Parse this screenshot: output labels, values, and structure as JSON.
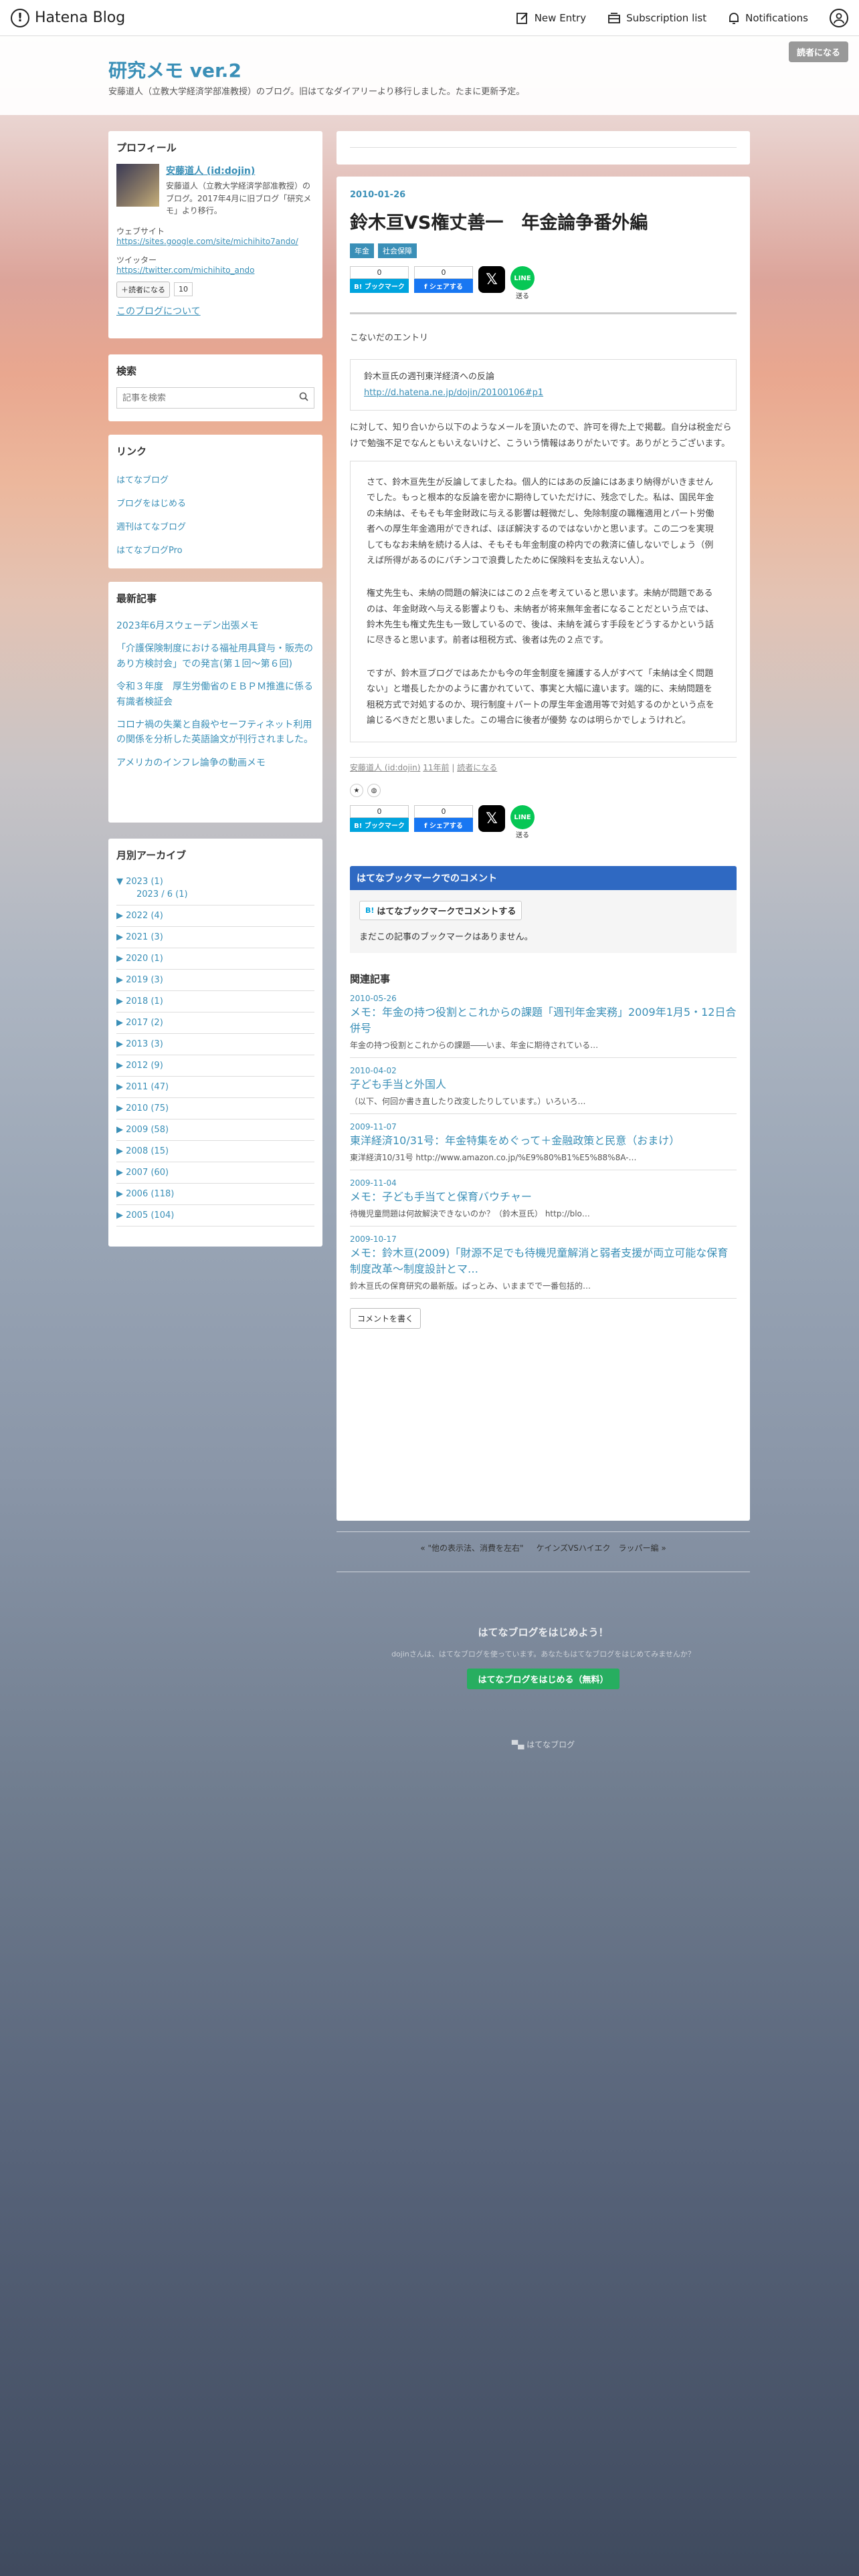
{
  "topbar": {
    "brand": "Hatena Blog",
    "new_entry": "New Entry",
    "subscription_list": "Subscription list",
    "notifications": "Notifications"
  },
  "header": {
    "title": "研究メモ ver.2",
    "description": "安藤道人（立教大学経済学部准教授）のブログ。旧はてなダイアリーより移行しました。たまに更新予定。",
    "reader_button": "読者になる"
  },
  "sidebar": {
    "profile": {
      "title": "プロフィール",
      "name": "安藤道人 (id:dojin)",
      "text": "安藤道人（立教大学経済学部准教授）のブログ。2017年4月に旧ブログ「研究メモ」より移行。",
      "website_label": "ウェブサイト",
      "website_url": "https://sites.google.com/site/michihito7ando/",
      "twitter_label": "ツイッター",
      "twitter_url": "https://twitter.com/michihito_ando",
      "follow_button": "読者になる",
      "follow_count": "10",
      "about_link": "このブログについて"
    },
    "search": {
      "title": "検索",
      "placeholder": "記事を検索"
    },
    "links": {
      "title": "リンク",
      "items": [
        "はてなブログ",
        "ブログをはじめる",
        "週刊はてなブログ",
        "はてなブログPro"
      ]
    },
    "recent": {
      "title": "最新記事",
      "items": [
        "2023年6月スウェーデン出張メモ",
        "「介護保険制度における福祉用具貸与・販売のあり方検討会」での発言(第１回〜第６回)",
        "令和３年度　厚生労働省のＥＢＰＭ推進に係る有識者検証会",
        "コロナ禍の失業と自殺やセーフティネット利用の関係を分析した英語論文が刊行されました。",
        "アメリカのインフレ論争の動画メモ"
      ]
    },
    "archive": {
      "title": "月別アーカイブ",
      "open_year": "▼ 2023 (1)",
      "open_month": "2023 / 6 (1)",
      "years": [
        "▶ 2022 (4)",
        "▶ 2021 (3)",
        "▶ 2020 (1)",
        "▶ 2019 (3)",
        "▶ 2018 (1)",
        "▶ 2017 (2)",
        "▶ 2013 (3)",
        "▶ 2012 (9)",
        "▶ 2011 (47)",
        "▶ 2010 (75)",
        "▶ 2009 (58)",
        "▶ 2008 (15)",
        "▶ 2007 (60)",
        "▶ 2006 (118)",
        "▶ 2005 (104)"
      ]
    }
  },
  "article": {
    "date": "2010-01-26",
    "title": "鈴木亘VS権丈善一　年金論争番外編",
    "tags": [
      "年金",
      "社会保障"
    ],
    "hatena_count": "0",
    "hatena_label": "B! ブックマーク",
    "fb_count": "0",
    "fb_label": "シェアする",
    "line_label": "送る",
    "intro": "こないだのエントリ",
    "quote1_text": "鈴木亘氏の週刊東洋経済への反論",
    "quote1_link": "http://d.hatena.ne.jp/dojin/20100106#p1",
    "para1": "に対して、知り合いから以下のようなメールを頂いたので、許可を得た上で掲載。自分は税金だらけで勉強不足でなんともいえないけど、こういう情報はありがたいです。ありがとうございます。",
    "quote2_p1": "さて、鈴木亘先生が反論してましたね。個人的にはあの反論にはあまり納得がいきませんでした。もっと根本的な反論を密かに期待していただけに、残念でした。私は、国民年金の未納は、そもそも年金財政に与える影響は軽微だし、免除制度の職権適用とパート労働者への厚生年金適用ができれば、ほぼ解決するのではないかと思います。この二つを実現してもなお未納を続ける人は、そもそも年金制度の枠内での救済に値しないでしょう（例えば所得があるのにパチンコで浪費したために保険料を支払えない人）。",
    "quote2_p2": "権丈先生も、未納の問題の解決にはこの２点を考えていると思います。未納が問題であるのは、年金財政へ与える影響よりも、未納者が将来無年金者になることだという点では、鈴木先生も権丈先生も一致しているので、後は、未納を減らす手段をどうするかという話に尽きると思います。前者は租税方式、後者は先の２点です。",
    "quote2_p3": "ですが、鈴木亘ブログではあたかも今の年金制度を擁護する人がすべて「未納は全く問題ない」と増長したかのように書かれていて、事実と大幅に違います。端的に、未納問題を租税方式で対処するのか、現行制度＋パートの厚生年金適用等で対処するのかという点を論じるべきだと思いました。この場合に後者が優勢 なのは明らかでしょうけれど。",
    "footer_author": "安藤道人 (id:dojin)",
    "footer_time": "11年前",
    "footer_reader": "読者になる",
    "bookmark_heading": "はてなブックマークでのコメント",
    "bookmark_button": "はてなブックマークでコメントする",
    "bookmark_none": "まだこの記事のブックマークはありません。",
    "related_title": "関連記事",
    "related": [
      {
        "date": "2010-05-26",
        "title": "メモ：年金の持つ役割とこれからの課題「週刊年金実務」2009年1月5・12日合併号",
        "snippet": "年金の持つ役割とこれからの課題――いま、年金に期待されている…"
      },
      {
        "date": "2010-04-02",
        "title": "子ども手当と外国人",
        "snippet": "（以下、何回か書き直したり改変したりしています。）いろいろ…"
      },
      {
        "date": "2009-11-07",
        "title": "東洋経済10/31号：年金特集をめぐって＋金融政策と民意（おまけ）",
        "snippet": "東洋経済10/31号 http://www.amazon.co.jp/%E9%80%B1%E5%88%8A-…"
      },
      {
        "date": "2009-11-04",
        "title": "メモ：子ども手当てと保育バウチャー",
        "snippet": "待機児童問題は何故解決できないのか？（鈴木亘氏） http://blo…"
      },
      {
        "date": "2009-10-17",
        "title": "メモ：鈴木亘(2009)「財源不足でも待機児童解消と弱者支援が両立可能な保育制度改革〜制度設計とマ…",
        "snippet": "鈴木亘氏の保育研究の最新版。ぱっとみ、いままでで一番包括的…"
      }
    ],
    "comment_button": "コメントを書く"
  },
  "pager": {
    "prev": "« \"他の表示法、消費を左右\"",
    "next": "ケインズVSハイエク　ラッパー編 »"
  },
  "promo": {
    "title": "はてなブログをはじめよう！",
    "sub": "dojinさんは、はてなブログを使っています。あなたもはてなブログをはじめてみませんか？",
    "button": "はてなブログをはじめる（無料）"
  },
  "footer": {
    "brand": "はてなブログ"
  }
}
